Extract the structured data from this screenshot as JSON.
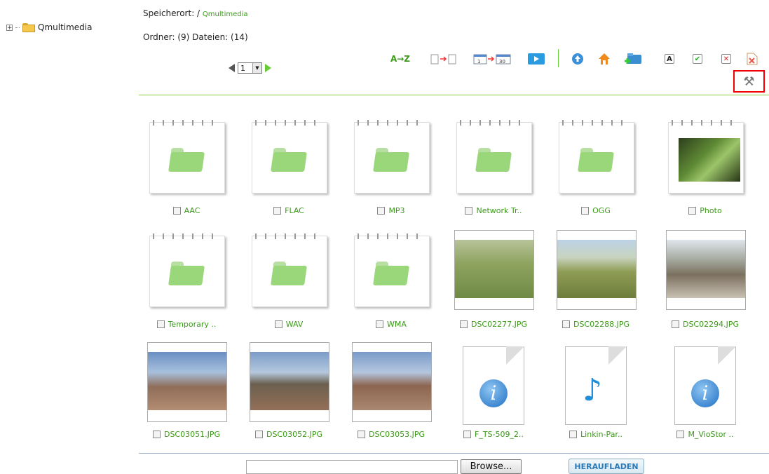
{
  "tree": {
    "root_label": "Qmultimedia"
  },
  "location": {
    "prefix": "Speicherort: /",
    "folder": "Qmultimedia"
  },
  "counts": "Ordner: (9) Dateien: (14)",
  "pager": {
    "page": "1"
  },
  "toolbar": {
    "sort_label": "A→Z",
    "icons": [
      "sort-az-icon",
      "file-transfer-icon",
      "calendar-range-icon",
      "slideshow-play-icon",
      "up-folder-icon",
      "home-icon",
      "new-folder-icon",
      "rename-icon",
      "select-all-icon",
      "deselect-all-icon",
      "delete-icon",
      "tools-icon"
    ]
  },
  "items": [
    {
      "name": "AAC",
      "kind": "folder"
    },
    {
      "name": "FLAC",
      "kind": "folder"
    },
    {
      "name": "MP3",
      "kind": "folder"
    },
    {
      "name": "Network Tr..",
      "kind": "folder"
    },
    {
      "name": "OGG",
      "kind": "folder"
    },
    {
      "name": "Photo",
      "kind": "folder-photo"
    },
    {
      "name": "Temporary ..",
      "kind": "folder"
    },
    {
      "name": "WAV",
      "kind": "folder"
    },
    {
      "name": "WMA",
      "kind": "folder"
    },
    {
      "name": "DSC02277.JPG",
      "kind": "photo"
    },
    {
      "name": "DSC02288.JPG",
      "kind": "photo"
    },
    {
      "name": "DSC02294.JPG",
      "kind": "photo"
    },
    {
      "name": "DSC03051.JPG",
      "kind": "photo"
    },
    {
      "name": "DSC03052.JPG",
      "kind": "photo"
    },
    {
      "name": "DSC03053.JPG",
      "kind": "photo"
    },
    {
      "name": "F_TS-509_2..",
      "kind": "info-doc"
    },
    {
      "name": "Linkin-Par..",
      "kind": "audio-doc"
    },
    {
      "name": "M_VioStor ..",
      "kind": "info-doc"
    }
  ],
  "upload": {
    "browse_label": "Browse...",
    "upload_label": "HERAUFLADEN"
  },
  "colors": {
    "accent_green": "#3a9a18",
    "separator_green": "#88cc33",
    "highlight_red": "#ee0000"
  }
}
